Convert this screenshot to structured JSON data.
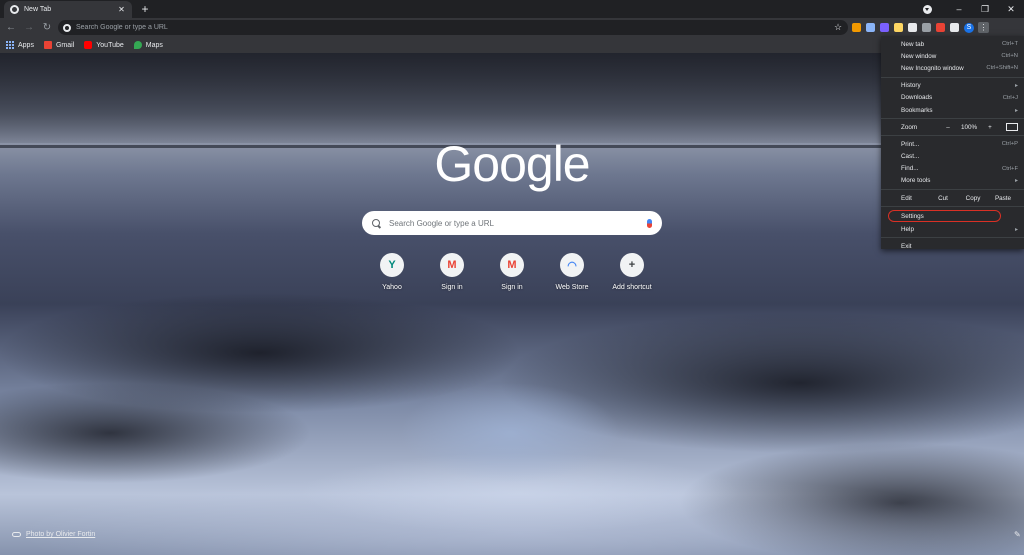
{
  "tab": {
    "title": "New Tab",
    "close": "✕"
  },
  "newtab": "+",
  "window": {
    "minimize": "–",
    "restore": "❐",
    "close": "✕"
  },
  "toolbar": {
    "back": "←",
    "forward": "→",
    "reload": "↻",
    "omnibox_placeholder": "Search Google or type a URL",
    "star": "☆",
    "profile_initial": "S",
    "menu": "⋮"
  },
  "extensions": [
    {
      "icon": "honey-icon",
      "color": "#f29900"
    },
    {
      "icon": "cursor-icon",
      "color": "#8ab4f8"
    },
    {
      "icon": "hexagon-icon",
      "color": "#7b61ff"
    },
    {
      "icon": "notes-icon",
      "color": "#fdd663"
    },
    {
      "icon": "dark-ext-icon",
      "color": "#e8eaed"
    },
    {
      "icon": "camera-icon",
      "color": "#9aa0a6"
    },
    {
      "icon": "pokeball-icon",
      "color": "#ea4335"
    },
    {
      "icon": "puzzle-icon",
      "color": "#e8eaed"
    }
  ],
  "bookmarks": [
    {
      "label": "Apps"
    },
    {
      "label": "Gmail",
      "color": "#ea4335"
    },
    {
      "label": "YouTube",
      "color": "#ff0000"
    },
    {
      "label": "Maps",
      "color": "#34a853"
    }
  ],
  "ntp": {
    "logo": "Google",
    "search_placeholder": "Search Google or type a URL",
    "shortcuts": [
      {
        "label": "Yahoo",
        "glyph": "Y",
        "color": "#00897b"
      },
      {
        "label": "Sign in",
        "glyph": "M",
        "color": "#ea4335"
      },
      {
        "label": "Sign in",
        "glyph": "M",
        "color": "#ea4335"
      },
      {
        "label": "Web Store",
        "glyph": "◠",
        "color": "#4285f4"
      },
      {
        "label": "Add shortcut",
        "glyph": "+",
        "color": "#3c4043"
      }
    ],
    "photo_credit": "Photo by Olivier Fortin"
  },
  "menu": {
    "new_tab": {
      "label": "New tab",
      "shortcut": "Ctrl+T"
    },
    "new_window": {
      "label": "New window",
      "shortcut": "Ctrl+N"
    },
    "incognito": {
      "label": "New Incognito window",
      "shortcut": "Ctrl+Shift+N"
    },
    "history": {
      "label": "History"
    },
    "downloads": {
      "label": "Downloads",
      "shortcut": "Ctrl+J"
    },
    "bookmarks": {
      "label": "Bookmarks"
    },
    "zoom": {
      "label": "Zoom",
      "minus": "–",
      "value": "100%",
      "plus": "+"
    },
    "print": {
      "label": "Print...",
      "shortcut": "Ctrl+P"
    },
    "cast": {
      "label": "Cast..."
    },
    "find": {
      "label": "Find...",
      "shortcut": "Ctrl+F"
    },
    "more_tools": {
      "label": "More tools"
    },
    "edit": {
      "label": "Edit",
      "cut": "Cut",
      "copy": "Copy",
      "paste": "Paste"
    },
    "settings": {
      "label": "Settings"
    },
    "help": {
      "label": "Help"
    },
    "exit": {
      "label": "Exit"
    },
    "arrow": "▸"
  }
}
